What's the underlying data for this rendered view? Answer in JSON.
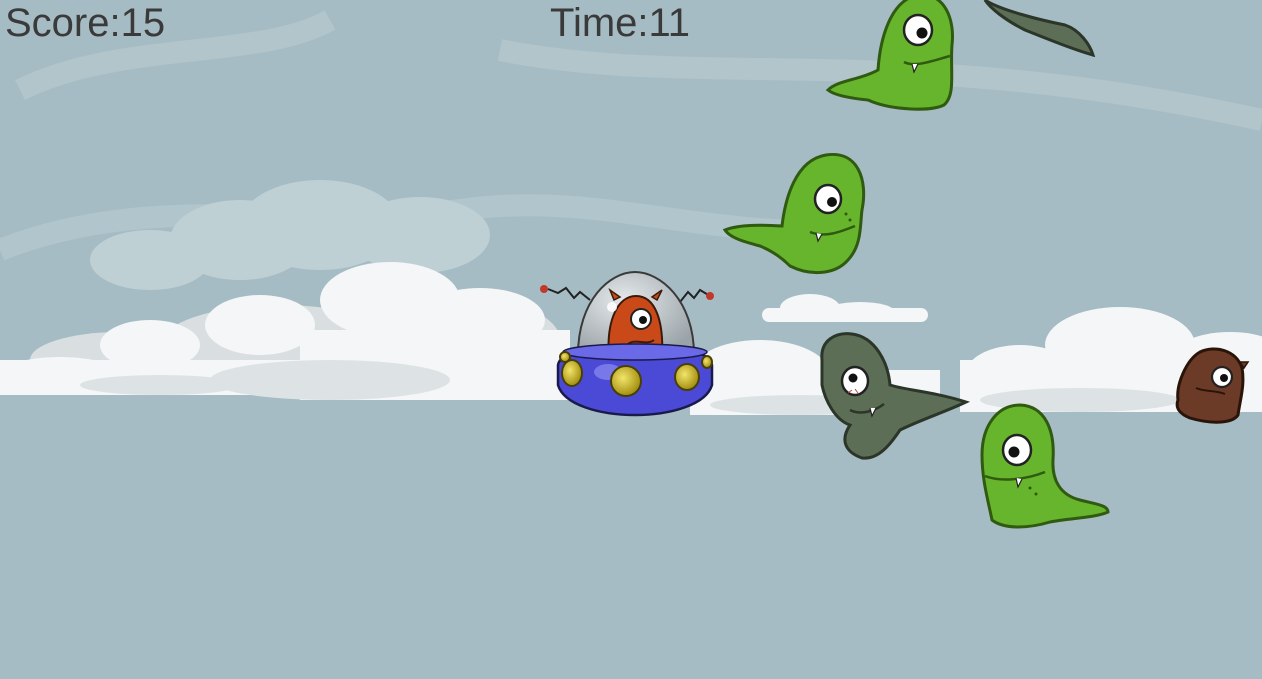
{
  "hud": {
    "score_text": "Score:15",
    "time_text": "Time:11"
  },
  "colors": {
    "sky": "#a6bcc4",
    "cloud": "#f4f6f7",
    "cloud_shade": "#d9dfe1",
    "hud_text": "#3a3a3a",
    "ufo_body": "#4a4ad6",
    "ufo_lights": "#c9b41a",
    "green_blob": "#66b52c",
    "gray_blob": "#5d6e57",
    "brown_blob": "#6b3b27",
    "pilot": "#c94a18"
  },
  "entities": {
    "player": {
      "kind": "ufo-with-alien-pilot"
    },
    "enemies": [
      {
        "kind": "green-one-eyed-slime"
      },
      {
        "kind": "green-one-eyed-slime"
      },
      {
        "kind": "green-one-eyed-slime"
      },
      {
        "kind": "gray-one-eyed-slime"
      },
      {
        "kind": "gray-slime-partial"
      },
      {
        "kind": "brown-one-eyed-slime"
      }
    ]
  }
}
